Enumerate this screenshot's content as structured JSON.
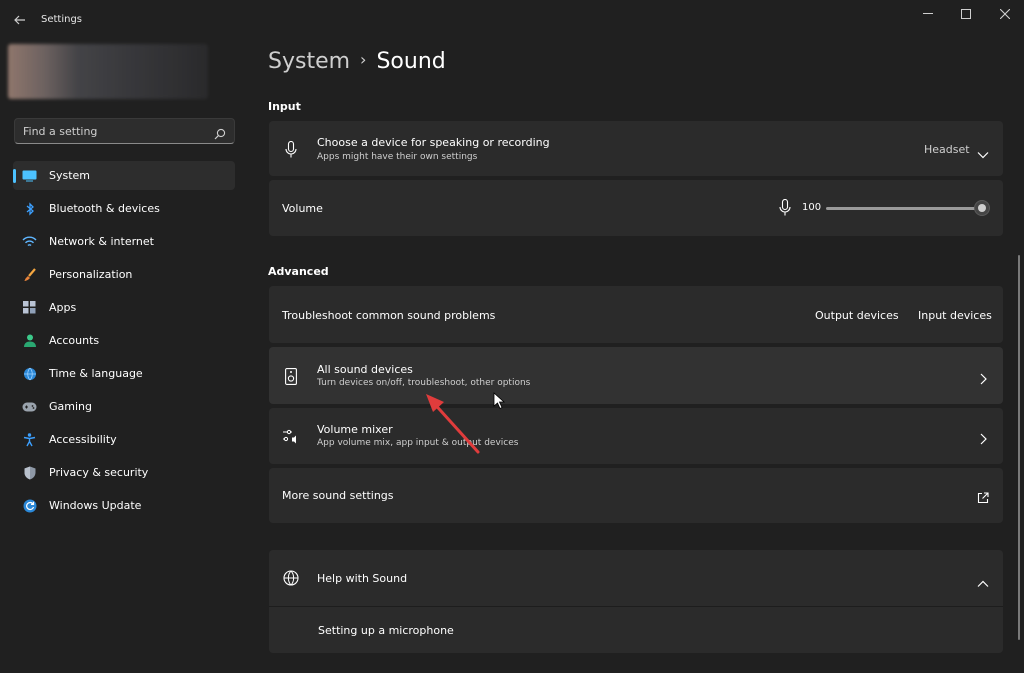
{
  "window": {
    "title": "Settings",
    "icons": {
      "back": "back-arrow-icon",
      "minimize": "minimize-icon",
      "maximize": "maximize-icon",
      "close": "close-icon"
    }
  },
  "sidebar": {
    "search": {
      "placeholder": "Find a setting",
      "icon": "search-icon"
    },
    "items": [
      {
        "label": "System",
        "icon": "monitor-icon",
        "active": true
      },
      {
        "label": "Bluetooth & devices",
        "icon": "bluetooth-icon"
      },
      {
        "label": "Network & internet",
        "icon": "wifi-icon"
      },
      {
        "label": "Personalization",
        "icon": "brush-icon"
      },
      {
        "label": "Apps",
        "icon": "apps-grid-icon"
      },
      {
        "label": "Accounts",
        "icon": "person-icon"
      },
      {
        "label": "Time & language",
        "icon": "globe-clock-icon"
      },
      {
        "label": "Gaming",
        "icon": "gamepad-icon"
      },
      {
        "label": "Accessibility",
        "icon": "accessibility-icon"
      },
      {
        "label": "Privacy & security",
        "icon": "shield-icon"
      },
      {
        "label": "Windows Update",
        "icon": "update-icon"
      }
    ]
  },
  "header": {
    "breadcrumb_parent": "System",
    "separator": "›",
    "current": "Sound"
  },
  "input": {
    "section_label": "Input",
    "device": {
      "title": "Choose a device for speaking or recording",
      "subtitle": "Apps might have their own settings",
      "selected": "Headset",
      "icon": "microphone-icon"
    },
    "volume": {
      "label": "Volume",
      "value": "100",
      "fraction": 1.0,
      "icon": "microphone-icon"
    }
  },
  "advanced": {
    "section_label": "Advanced",
    "troubleshoot": {
      "label": "Troubleshoot common sound problems",
      "output_link": "Output devices",
      "input_link": "Input devices"
    },
    "all_devices": {
      "title": "All sound devices",
      "subtitle": "Turn devices on/off, troubleshoot, other options",
      "icon": "speaker-icon"
    },
    "mixer": {
      "title": "Volume mixer",
      "subtitle": "App volume mix, app input & output devices",
      "icon": "mixer-icon"
    },
    "more": {
      "label": "More sound settings",
      "icon": "external-link-icon"
    }
  },
  "help": {
    "title": "Help with Sound",
    "icon": "globe-icon",
    "link": "Setting up a microphone"
  },
  "colors": {
    "accent": "#4cc2ff",
    "background": "#202020",
    "card": "#2b2b2b",
    "annotation_arrow": "#e03c3c"
  }
}
